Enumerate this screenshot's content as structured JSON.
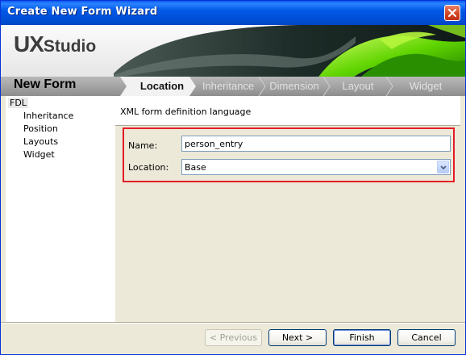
{
  "window": {
    "title": "Create New Form Wizard"
  },
  "banner": {
    "logo_ux": "UX",
    "logo_studio": "Studio",
    "page_name": "New Form",
    "steps": [
      {
        "label": "Location",
        "active": true
      },
      {
        "label": "Inheritance",
        "active": false
      },
      {
        "label": "Dimension",
        "active": false
      },
      {
        "label": "Layout",
        "active": false
      },
      {
        "label": "Widget",
        "active": false
      }
    ]
  },
  "tree": {
    "root": "FDL",
    "items": [
      "Inheritance",
      "Position",
      "Layouts",
      "Widget"
    ]
  },
  "content": {
    "description": "XML form definition language",
    "name_label": "Name:",
    "name_value": "person_entry",
    "location_label": "Location:",
    "location_value": "Base"
  },
  "buttons": {
    "previous": "< Previous",
    "next": "Next >",
    "finish": "Finish",
    "cancel": "Cancel"
  },
  "colors": {
    "title_bar": "#0054e3",
    "highlight_border": "#e31c25",
    "banner_accent": "#6ad400"
  },
  "icons": {
    "close": "close-icon",
    "dropdown": "chevron-down-icon"
  }
}
